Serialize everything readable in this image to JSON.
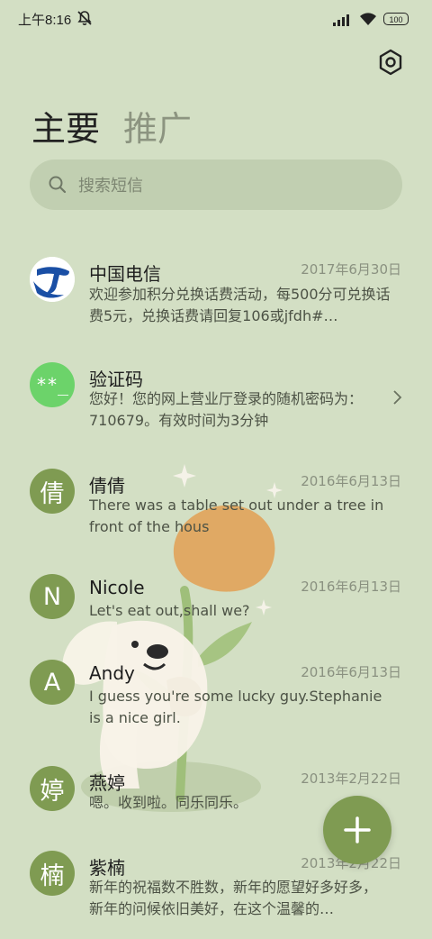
{
  "status_bar": {
    "time": "上午8:16",
    "battery": "100"
  },
  "header": {
    "tab_main": "主要",
    "tab_promo": "推广"
  },
  "search": {
    "placeholder": "搜索短信"
  },
  "colors": {
    "background": "#d3dfc4",
    "accent_green": "#7f9b52",
    "search_bg": "#c1cfb1"
  },
  "messages": [
    {
      "sender": "中国电信",
      "date": "2017年6月30日",
      "preview": "欢迎参加积分兑换话费活动，每500分可兑换话费5元，兑换话费请回复106或jfdh#…",
      "avatar_text": "",
      "avatar_icon": "china-telecom-logo"
    },
    {
      "sender": "验证码",
      "date": "",
      "preview": "您好！您的网上营业厅登录的随机密码为：710679。有效时间为3分钟",
      "avatar_text": "**_",
      "avatar_color": "#6cd36a"
    },
    {
      "sender": "倩倩",
      "date": "2016年6月13日",
      "preview": "There was a table set out under a tree in front of the hous",
      "avatar_text": "倩",
      "avatar_color": "#7f9b52"
    },
    {
      "sender": "Nicole",
      "date": "2016年6月13日",
      "preview": "Let's eat out,shall we?",
      "avatar_text": "N",
      "avatar_color": "#7f9b52"
    },
    {
      "sender": "Andy",
      "date": "2016年6月13日",
      "preview": "I guess you're some lucky guy.Stephanie is a nice girl.",
      "avatar_text": "A",
      "avatar_color": "#7f9b52"
    },
    {
      "sender": "燕婷",
      "date": "2013年2月22日",
      "preview": "嗯。收到啦。同乐同乐。",
      "avatar_text": "婷",
      "avatar_color": "#7f9b52"
    },
    {
      "sender": "紫楠",
      "date": "2013年2月22日",
      "preview": "新年的祝福数不胜数，新年的愿望好多好多，新年的问候依旧美好，在这个温馨的…",
      "avatar_text": "楠",
      "avatar_color": "#7f9b52"
    }
  ]
}
